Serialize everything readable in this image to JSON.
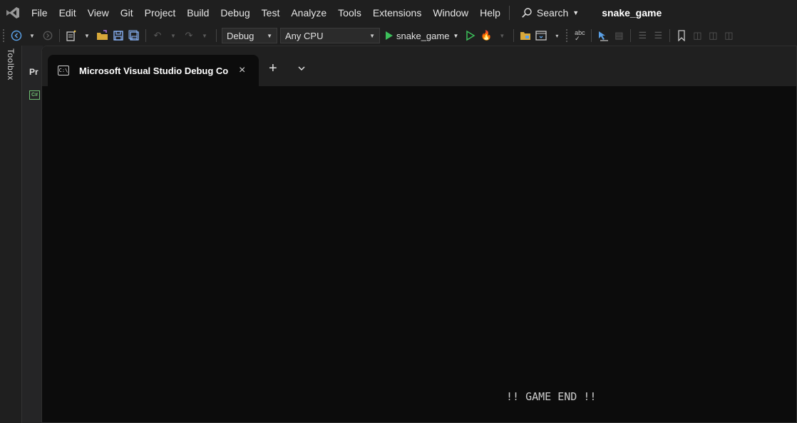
{
  "menubar": {
    "items": [
      "File",
      "Edit",
      "View",
      "Git",
      "Project",
      "Build",
      "Debug",
      "Test",
      "Analyze",
      "Tools",
      "Extensions",
      "Window",
      "Help"
    ],
    "search_label": "Search",
    "solution_name": "snake_game"
  },
  "toolbar": {
    "configuration": "Debug",
    "platform": "Any CPU",
    "startup_project": "snake_game",
    "accent_run_color": "#3cbf5a"
  },
  "sidebar": {
    "toolbox_label": "Toolbox",
    "panel_title_partial": "Pr",
    "csharp_badge": "C#"
  },
  "console": {
    "tab_title": "Microsoft Visual Studio Debug Console",
    "tab_icon_text": "C:\\",
    "close_glyph": "×",
    "new_tab_glyph": "+",
    "output_text": "!! GAME END !!"
  }
}
